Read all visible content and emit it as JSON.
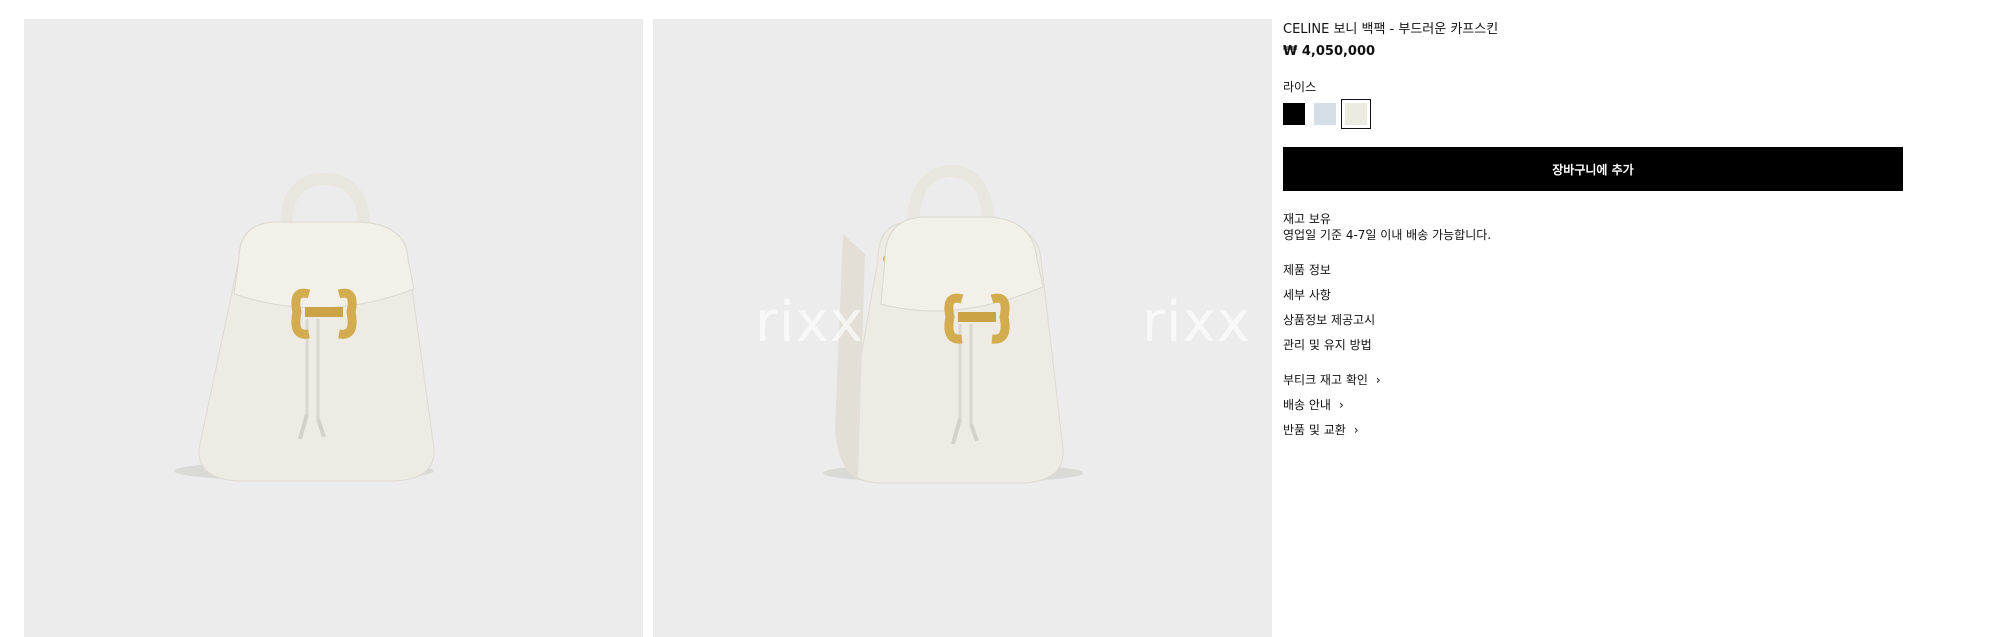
{
  "gallery": {
    "watermark": "rixx"
  },
  "product": {
    "title": "CELINE 보니 백팩 - 부드러운 카프스킨",
    "price": "₩ 4,050,000",
    "color_name": "라이스",
    "swatches": [
      {
        "name": "black",
        "color": "#000000",
        "selected": false
      },
      {
        "name": "light-blue",
        "color": "#d4dee7",
        "selected": false
      },
      {
        "name": "rice",
        "color": "#ecebe0",
        "selected": true
      }
    ],
    "add_to_cart": "장바구니에 추가",
    "stock_status": "재고 보유",
    "shipping_note": "영업일 기준 4-7일 이내 배송 가능합니다."
  },
  "info_links": [
    "제품 정보",
    "세부 사항",
    "상품정보 제공고시",
    "관리 및 유지 방법"
  ],
  "service_links": [
    "부티크 재고 확인",
    "배송 안내",
    "반품 및 교환"
  ],
  "colors": {
    "gallery_bg": "#ececec",
    "bag": "#eeebe4",
    "hardware": "#d2ac4e"
  }
}
